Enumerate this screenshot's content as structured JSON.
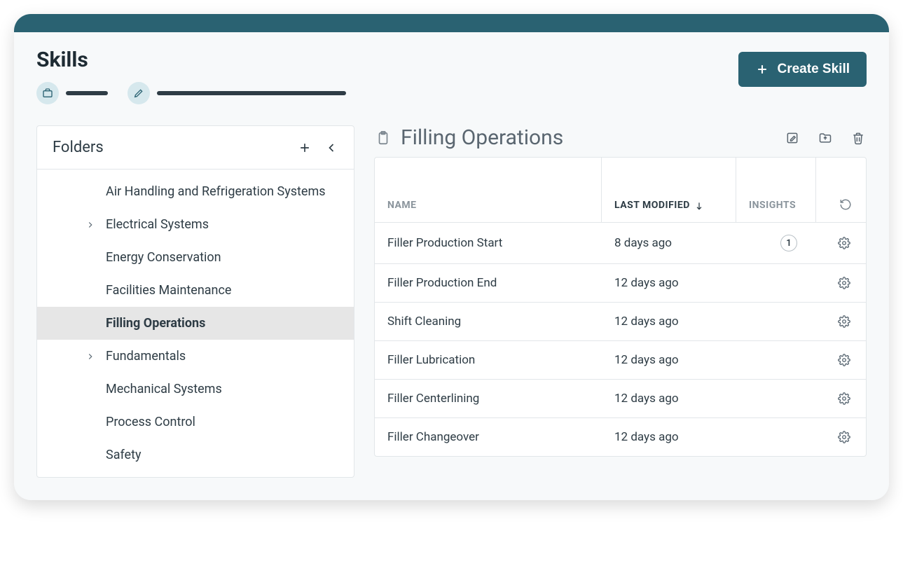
{
  "header": {
    "title": "Skills",
    "create_button": "Create Skill"
  },
  "folders_panel": {
    "title": "Folders",
    "items": [
      {
        "label": "Air Handling and Refrigeration Systems",
        "expandable": false,
        "selected": false
      },
      {
        "label": "Electrical Systems",
        "expandable": true,
        "selected": false
      },
      {
        "label": "Energy Conservation",
        "expandable": false,
        "selected": false
      },
      {
        "label": "Facilities Maintenance",
        "expandable": false,
        "selected": false
      },
      {
        "label": "Filling Operations",
        "expandable": false,
        "selected": true
      },
      {
        "label": "Fundamentals",
        "expandable": true,
        "selected": false
      },
      {
        "label": "Mechanical Systems",
        "expandable": false,
        "selected": false
      },
      {
        "label": "Process Control",
        "expandable": false,
        "selected": false
      },
      {
        "label": "Safety",
        "expandable": false,
        "selected": false
      }
    ]
  },
  "main": {
    "title": "Filling Operations",
    "columns": {
      "name": "Name",
      "modified": "Last Modified",
      "insights": "Insights"
    },
    "sort": {
      "column": "modified",
      "dir": "desc"
    },
    "rows": [
      {
        "name": "Filler Production Start",
        "modified": "8 days ago",
        "insights": "1"
      },
      {
        "name": "Filler Production End",
        "modified": "12 days ago",
        "insights": ""
      },
      {
        "name": "Shift Cleaning",
        "modified": "12 days ago",
        "insights": ""
      },
      {
        "name": "Filler Lubrication",
        "modified": "12 days ago",
        "insights": ""
      },
      {
        "name": "Filler Centerlining",
        "modified": "12 days ago",
        "insights": ""
      },
      {
        "name": "Filler Changeover",
        "modified": "12 days ago",
        "insights": ""
      }
    ]
  }
}
